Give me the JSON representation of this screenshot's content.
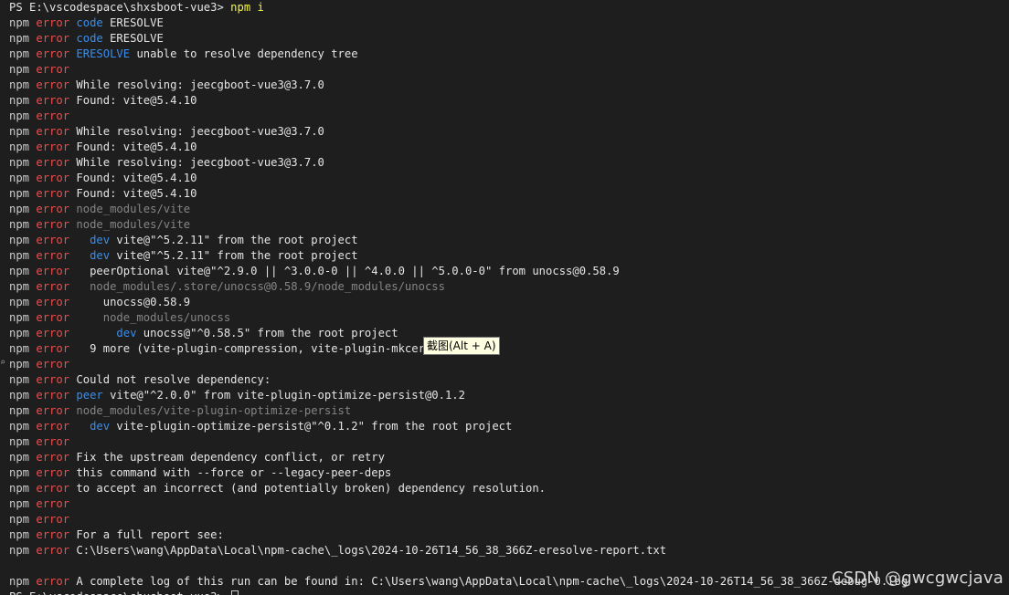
{
  "terminal": {
    "lines": [
      [
        {
          "t": "PS E:\\vscodespace\\shxsboot-vue3> ",
          "c": "white"
        },
        {
          "t": "npm i",
          "c": "yellow"
        }
      ],
      [
        {
          "t": "npm ",
          "c": "npm"
        },
        {
          "t": "error ",
          "c": "err"
        },
        {
          "t": "code ",
          "c": "blue"
        },
        {
          "t": "ERESOLVE",
          "c": "white"
        }
      ],
      [
        {
          "t": "npm ",
          "c": "npm"
        },
        {
          "t": "error ",
          "c": "err"
        },
        {
          "t": "code ",
          "c": "blue"
        },
        {
          "t": "ERESOLVE",
          "c": "white"
        }
      ],
      [
        {
          "t": "npm ",
          "c": "npm"
        },
        {
          "t": "error ",
          "c": "err"
        },
        {
          "t": "ERESOLVE ",
          "c": "blue"
        },
        {
          "t": "unable to resolve dependency tree",
          "c": "white"
        }
      ],
      [
        {
          "t": "npm ",
          "c": "npm"
        },
        {
          "t": "error",
          "c": "err"
        }
      ],
      [
        {
          "t": "npm ",
          "c": "npm"
        },
        {
          "t": "error ",
          "c": "err"
        },
        {
          "t": "While resolving: jeecgboot-vue3@3.7.0",
          "c": "white"
        }
      ],
      [
        {
          "t": "npm ",
          "c": "npm"
        },
        {
          "t": "error ",
          "c": "err"
        },
        {
          "t": "Found: vite@5.4.10",
          "c": "white"
        }
      ],
      [
        {
          "t": "npm ",
          "c": "npm"
        },
        {
          "t": "error",
          "c": "err"
        }
      ],
      [
        {
          "t": "npm ",
          "c": "npm"
        },
        {
          "t": "error ",
          "c": "err"
        },
        {
          "t": "While resolving: jeecgboot-vue3@3.7.0",
          "c": "white"
        }
      ],
      [
        {
          "t": "npm ",
          "c": "npm"
        },
        {
          "t": "error ",
          "c": "err"
        },
        {
          "t": "Found: vite@5.4.10",
          "c": "white"
        }
      ],
      [
        {
          "t": "npm ",
          "c": "npm"
        },
        {
          "t": "error ",
          "c": "err"
        },
        {
          "t": "While resolving: jeecgboot-vue3@3.7.0",
          "c": "white"
        }
      ],
      [
        {
          "t": "npm ",
          "c": "npm"
        },
        {
          "t": "error ",
          "c": "err"
        },
        {
          "t": "Found: vite@5.4.10",
          "c": "white"
        }
      ],
      [
        {
          "t": "npm ",
          "c": "npm"
        },
        {
          "t": "error ",
          "c": "err"
        },
        {
          "t": "Found: vite@5.4.10",
          "c": "white"
        }
      ],
      [
        {
          "t": "npm ",
          "c": "npm"
        },
        {
          "t": "error ",
          "c": "err"
        },
        {
          "t": "node_modules/vite",
          "c": "gray"
        }
      ],
      [
        {
          "t": "npm ",
          "c": "npm"
        },
        {
          "t": "error ",
          "c": "err"
        },
        {
          "t": "node_modules/vite",
          "c": "gray"
        }
      ],
      [
        {
          "t": "npm ",
          "c": "npm"
        },
        {
          "t": "error ",
          "c": "err"
        },
        {
          "t": "  dev ",
          "c": "blue"
        },
        {
          "t": "vite@\"^5.2.11\" from the root project",
          "c": "white"
        }
      ],
      [
        {
          "t": "npm ",
          "c": "npm"
        },
        {
          "t": "error ",
          "c": "err"
        },
        {
          "t": "  dev ",
          "c": "blue"
        },
        {
          "t": "vite@\"^5.2.11\" from the root project",
          "c": "white"
        }
      ],
      [
        {
          "t": "npm ",
          "c": "npm"
        },
        {
          "t": "error ",
          "c": "err"
        },
        {
          "t": "  peerOptional vite@\"^2.9.0 || ^3.0.0-0 || ^4.0.0 || ^5.0.0-0\" from unocss@0.58.9",
          "c": "white"
        }
      ],
      [
        {
          "t": "npm ",
          "c": "npm"
        },
        {
          "t": "error ",
          "c": "err"
        },
        {
          "t": "  node_modules/.store/unocss@0.58.9/node_modules/unocss",
          "c": "gray"
        }
      ],
      [
        {
          "t": "npm ",
          "c": "npm"
        },
        {
          "t": "error ",
          "c": "err"
        },
        {
          "t": "    unocss@0.58.9",
          "c": "white"
        }
      ],
      [
        {
          "t": "npm ",
          "c": "npm"
        },
        {
          "t": "error ",
          "c": "err"
        },
        {
          "t": "    node_modules/unocss",
          "c": "gray"
        }
      ],
      [
        {
          "t": "npm ",
          "c": "npm"
        },
        {
          "t": "error ",
          "c": "err"
        },
        {
          "t": "      dev ",
          "c": "blue"
        },
        {
          "t": "unocss@\"^0.58.5\" from the root project",
          "c": "white"
        }
      ],
      [
        {
          "t": "npm ",
          "c": "npm"
        },
        {
          "t": "error ",
          "c": "err"
        },
        {
          "t": "  9 more (vite-plugin-compression, vite-plugin-mkcert, ...)",
          "c": "white"
        }
      ],
      [
        {
          "t": "npm ",
          "c": "npm"
        },
        {
          "t": "error",
          "c": "err"
        }
      ],
      [
        {
          "t": "npm ",
          "c": "npm"
        },
        {
          "t": "error ",
          "c": "err"
        },
        {
          "t": "Could not resolve dependency:",
          "c": "white"
        }
      ],
      [
        {
          "t": "npm ",
          "c": "npm"
        },
        {
          "t": "error ",
          "c": "err"
        },
        {
          "t": "peer ",
          "c": "blue"
        },
        {
          "t": "vite@\"^2.0.0\" from vite-plugin-optimize-persist@0.1.2",
          "c": "white"
        }
      ],
      [
        {
          "t": "npm ",
          "c": "npm"
        },
        {
          "t": "error ",
          "c": "err"
        },
        {
          "t": "node_modules/vite-plugin-optimize-persist",
          "c": "gray"
        }
      ],
      [
        {
          "t": "npm ",
          "c": "npm"
        },
        {
          "t": "error ",
          "c": "err"
        },
        {
          "t": "  dev ",
          "c": "blue"
        },
        {
          "t": "vite-plugin-optimize-persist@\"^0.1.2\" from the root project",
          "c": "white"
        }
      ],
      [
        {
          "t": "npm ",
          "c": "npm"
        },
        {
          "t": "error",
          "c": "err"
        }
      ],
      [
        {
          "t": "npm ",
          "c": "npm"
        },
        {
          "t": "error ",
          "c": "err"
        },
        {
          "t": "Fix the upstream dependency conflict, or retry",
          "c": "white"
        }
      ],
      [
        {
          "t": "npm ",
          "c": "npm"
        },
        {
          "t": "error ",
          "c": "err"
        },
        {
          "t": "this command with --force or --legacy-peer-deps",
          "c": "white"
        }
      ],
      [
        {
          "t": "npm ",
          "c": "npm"
        },
        {
          "t": "error ",
          "c": "err"
        },
        {
          "t": "to accept an incorrect (and potentially broken) dependency resolution.",
          "c": "white"
        }
      ],
      [
        {
          "t": "npm ",
          "c": "npm"
        },
        {
          "t": "error",
          "c": "err"
        }
      ],
      [
        {
          "t": "npm ",
          "c": "npm"
        },
        {
          "t": "error",
          "c": "err"
        }
      ],
      [
        {
          "t": "npm ",
          "c": "npm"
        },
        {
          "t": "error ",
          "c": "err"
        },
        {
          "t": "For a full report see:",
          "c": "white"
        }
      ],
      [
        {
          "t": "npm ",
          "c": "npm"
        },
        {
          "t": "error ",
          "c": "err"
        },
        {
          "t": "C:\\Users\\wang\\AppData\\Local\\npm-cache\\_logs\\2024-10-26T14_56_38_366Z-eresolve-report.txt",
          "c": "white"
        }
      ],
      [],
      [
        {
          "t": "npm ",
          "c": "npm"
        },
        {
          "t": "error ",
          "c": "err"
        },
        {
          "t": "A complete log of this run can be found in: C:\\Users\\wang\\AppData\\Local\\npm-cache\\_logs\\2024-10-26T14_56_38_366Z-debug-0.log",
          "c": "white"
        }
      ],
      [
        {
          "t": "PS E:\\vscodespace\\shxsboot-vue3> ",
          "c": "white"
        }
      ]
    ],
    "colors": {
      "background": "#1e1e1e",
      "npm": "#cccccc",
      "error": "#f14c4c",
      "keyword": "#3b8eea",
      "path": "#858585",
      "text": "#e5e5e5",
      "command": "#f5f543"
    }
  },
  "tooltip": {
    "text": "截图(Alt + A)"
  },
  "watermark": {
    "text": "CSDN @gwcgwcjava"
  }
}
